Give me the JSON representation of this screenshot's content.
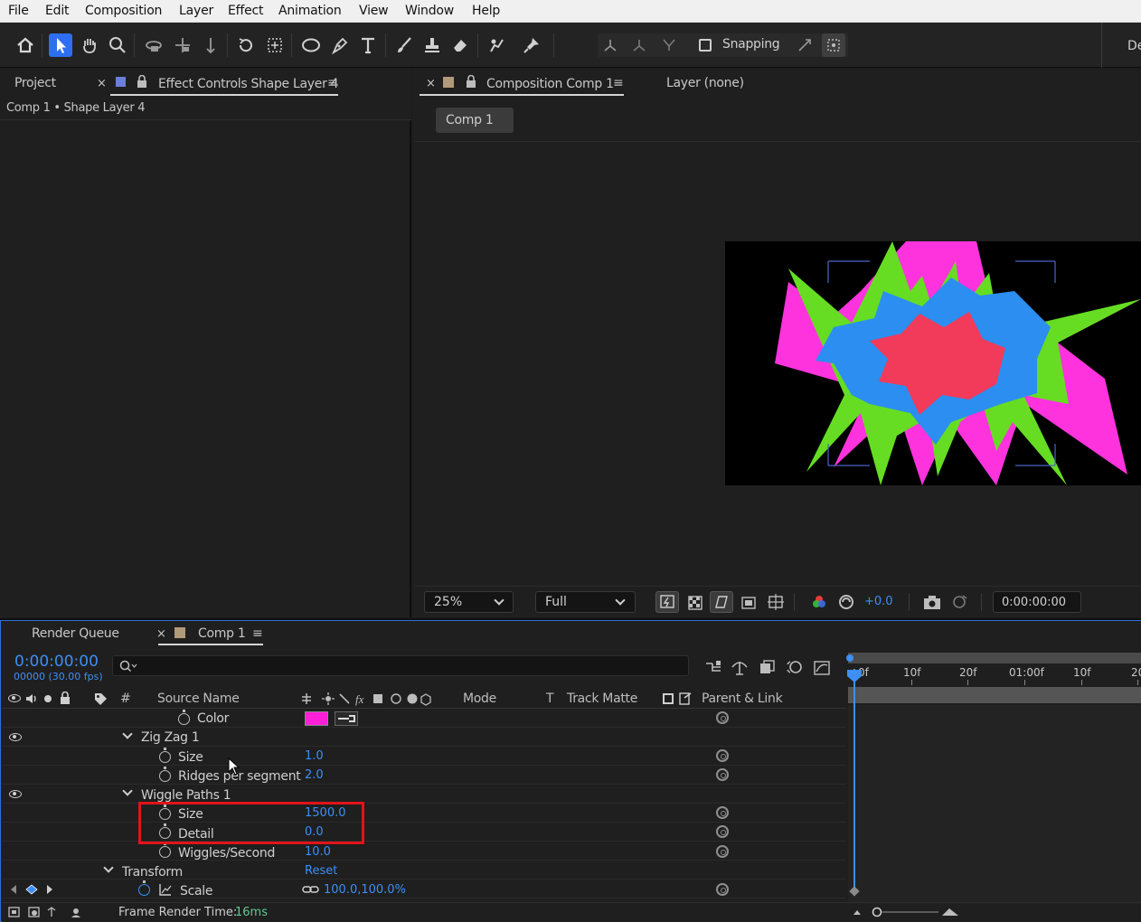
{
  "menu": [
    "File",
    "Edit",
    "Composition",
    "Layer",
    "Effect",
    "Animation",
    "View",
    "Window",
    "Help"
  ],
  "toolbar": {
    "tools": [
      "home-icon",
      "selection-tool-icon",
      "hand-tool-icon",
      "zoom-tool-icon",
      "orbit-camera-icon",
      "pan-camera-icon",
      "dolly-camera-icon",
      "rotation-tool-icon",
      "pan-behind-icon",
      "ellipse-tool-icon",
      "pen-tool-icon",
      "type-tool-icon",
      "brush-tool-icon",
      "clone-stamp-icon",
      "eraser-tool-icon",
      "roto-brush-icon",
      "puppet-pin-icon"
    ],
    "snapping_label": "Snapping",
    "workspace_label": "De"
  },
  "left_panel": {
    "tab_project": "Project",
    "tab_effect_controls": "Effect Controls Shape Layer 4",
    "close_glyph": "×",
    "menu_glyph": "≡",
    "subtitle": "Comp 1 • Shape Layer 4"
  },
  "comp_panel": {
    "close_glyph": "×",
    "tab_composition": "Composition Comp 1",
    "menu_glyph": "≡",
    "tab_layer": "Layer (none)",
    "flow_chip": "Comp 1",
    "zoom": "25%",
    "resolution": "Full",
    "exposure": "+0.0",
    "timecode": "0:00:00:00",
    "colors": {
      "bg": "#000000",
      "magenta": "#ff33dd",
      "green": "#66dd22",
      "blue": "#2b8ef0",
      "red": "#f23a5a"
    }
  },
  "timeline": {
    "tab_render_queue": "Render Queue",
    "close_glyph": "×",
    "tab_comp": "Comp 1",
    "menu_glyph": "≡",
    "timecode": "0:00:00:00",
    "frames": "00000 (30.00 fps)",
    "search_icon": "search-icon",
    "headers": {
      "hash": "#",
      "source_name": "Source Name",
      "mode": "Mode",
      "t": "T",
      "track_matte": "Track Matte",
      "parent_link": "Parent & Link"
    },
    "ruler": [
      "0f",
      "10f",
      "20f",
      "01:00f",
      "10f",
      "20"
    ],
    "rows": [
      {
        "label": "Color",
        "value": ""
      },
      {
        "label": "Zig Zag 1",
        "value": ""
      },
      {
        "label": "Size",
        "value": "1.0"
      },
      {
        "label": "Ridges per segment",
        "value": "2.0"
      },
      {
        "label": "Wiggle Paths 1",
        "value": ""
      },
      {
        "label": "Size",
        "value": "1500.0"
      },
      {
        "label": "Detail",
        "value": "0.0"
      },
      {
        "label": "Wiggles/Second",
        "value": "10.0"
      },
      {
        "label": "Transform",
        "value": "Reset"
      },
      {
        "label": "Scale",
        "value": "100.0,100.0%"
      }
    ],
    "color_swatch": "#ff1fd8",
    "highlight_color": "#e0141a",
    "footer_label": "Frame Render Time:",
    "footer_value": "16ms"
  }
}
